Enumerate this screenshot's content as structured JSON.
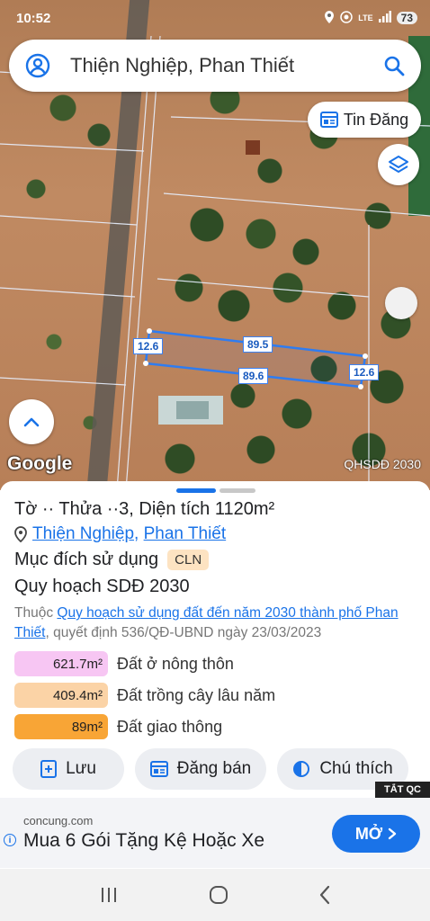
{
  "status_bar": {
    "time": "10:52",
    "network": "LTE",
    "battery": "73"
  },
  "search": {
    "text": "Thiện Nghiệp, Phan Thiết"
  },
  "map": {
    "tin_dang_label": "Tin Đăng",
    "google_logo": "Google",
    "layer_label": "QHSDĐ 2030",
    "dimensions": {
      "top": "89.5",
      "bottom": "89.6",
      "left": "12.6",
      "right": "12.6"
    }
  },
  "parcel": {
    "title": "Tờ ·· Thửa ··3, Diện tích 1120m²",
    "location": {
      "commune": "Thiện Nghiệp",
      "separator": ", ",
      "city": "Phan Thiết"
    },
    "purpose_label": "Mục đích sử dụng",
    "purpose_code": "CLN",
    "plan_title": "Quy hoạch SDĐ 2030",
    "source_prefix": "Thuộc ",
    "source_link": "Quy hoạch sử dụng đất đến năm 2030 thành phố Phan Thiết",
    "source_suffix": ", quyết định 536/QĐ-UBND ngày 23/03/2023",
    "legend": [
      {
        "area": "621.7m²",
        "label": "Đất ở nông thôn",
        "color": "#f7c6f3"
      },
      {
        "area": "409.4m²",
        "label": "Đất trồng cây lâu năm",
        "color": "#fbd3a6"
      },
      {
        "area": "89m²",
        "label": "Đất giao thông",
        "color": "#f8a536"
      }
    ]
  },
  "actions": {
    "save": "Lưu",
    "post_sale": "Đăng bán",
    "legend": "Chú thích"
  },
  "ad": {
    "close_label": "TẮT QC",
    "domain": "concung.com",
    "title": "Mua 6 Gói Tặng Kệ Hoặc Xe",
    "cta": "MỞ"
  }
}
